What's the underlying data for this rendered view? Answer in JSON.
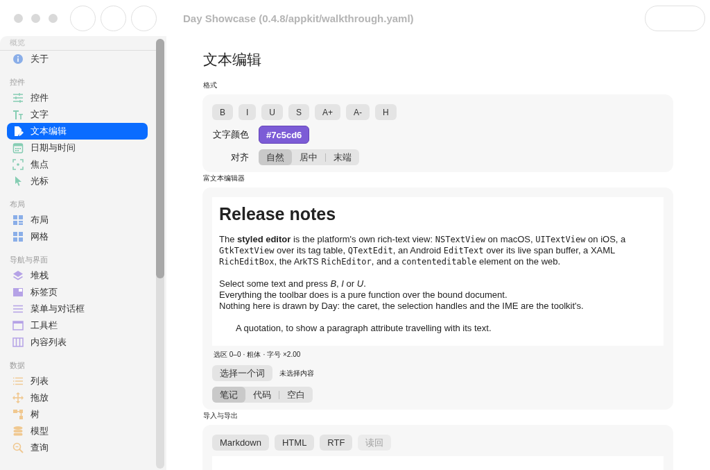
{
  "window": {
    "title": "Day Showcase (0.4.8/appkit/walkthrough.yaml)"
  },
  "sidebar": {
    "sections": [
      {
        "header": "概览",
        "items": [
          {
            "label": "关于",
            "kind": "info",
            "selected": false
          }
        ]
      },
      {
        "header": "控件",
        "items": [
          {
            "label": "控件",
            "kind": "sliders",
            "selected": false
          },
          {
            "label": "文字",
            "kind": "text",
            "selected": false
          },
          {
            "label": "文本编辑",
            "kind": "edit",
            "selected": true
          },
          {
            "label": "日期与时间",
            "kind": "calendar",
            "selected": false
          },
          {
            "label": "焦点",
            "kind": "focus",
            "selected": false
          },
          {
            "label": "光标",
            "kind": "cursor",
            "selected": false
          }
        ]
      },
      {
        "header": "布局",
        "items": [
          {
            "label": "布局",
            "kind": "layout",
            "selected": false
          },
          {
            "label": "网格",
            "kind": "grid",
            "selected": false
          }
        ]
      },
      {
        "header": "导航与界面",
        "items": [
          {
            "label": "堆栈",
            "kind": "stack",
            "selected": false
          },
          {
            "label": "标签页",
            "kind": "tab",
            "selected": false
          },
          {
            "label": "菜单与对话框",
            "kind": "menu",
            "selected": false
          },
          {
            "label": "工具栏",
            "kind": "toolbar",
            "selected": false
          },
          {
            "label": "内容列表",
            "kind": "columns",
            "selected": false
          }
        ]
      },
      {
        "header": "数据",
        "items": [
          {
            "label": "列表",
            "kind": "list",
            "selected": false
          },
          {
            "label": "拖放",
            "kind": "move",
            "selected": false
          },
          {
            "label": "树",
            "kind": "tree",
            "selected": false
          },
          {
            "label": "模型",
            "kind": "database",
            "selected": false
          },
          {
            "label": "查询",
            "kind": "search",
            "selected": false
          }
        ]
      }
    ]
  },
  "page": {
    "title": "文本编辑",
    "format": {
      "label": "格式",
      "buttons": [
        "B",
        "I",
        "U",
        "S",
        "A+",
        "A-",
        "H"
      ],
      "color_label": "文字颜色",
      "color_value": "#7c5cd6",
      "align_label": "对齐",
      "align": [
        {
          "label": "自然",
          "selected": true
        },
        {
          "label": "居中",
          "selected": false
        },
        {
          "label": "末端",
          "selected": false
        }
      ]
    },
    "rich": {
      "label": "富文本编辑器",
      "heading": "Release notes",
      "blocks": [
        {
          "kind": "para",
          "lines": [
            [
              {
                "kind": "plain",
                "text": "The "
              },
              {
                "kind": "bold",
                "text": "styled editor"
              },
              {
                "kind": "plain",
                "text": " is the platform's own rich-text view: "
              },
              {
                "kind": "code",
                "text": "NSTextView"
              },
              {
                "kind": "plain",
                "text": " on macOS, "
              },
              {
                "kind": "code",
                "text": "UITextView"
              },
              {
                "kind": "plain",
                "text": " on iOS, a "
              },
              {
                "kind": "code",
                "text": "GtkTextView"
              },
              {
                "kind": "plain",
                "text": " over its tag table, "
              },
              {
                "kind": "code",
                "text": "QTextEdit"
              },
              {
                "kind": "plain",
                "text": ", an Android "
              },
              {
                "kind": "code",
                "text": "EditText"
              },
              {
                "kind": "plain",
                "text": " over its live span buffer, a XAML "
              },
              {
                "kind": "code",
                "text": "RichEditBox"
              },
              {
                "kind": "plain",
                "text": ", the ArkTS "
              },
              {
                "kind": "code",
                "text": "RichEditor"
              },
              {
                "kind": "plain",
                "text": ", and a "
              },
              {
                "kind": "code",
                "text": "contenteditable"
              },
              {
                "kind": "plain",
                "text": " element on the web."
              }
            ]
          ]
        },
        {
          "kind": "para",
          "lines": [
            [
              {
                "kind": "plain",
                "text": "Select some text and press "
              },
              {
                "kind": "italic",
                "text": "B"
              },
              {
                "kind": "plain",
                "text": ", "
              },
              {
                "kind": "italic",
                "text": "I"
              },
              {
                "kind": "plain",
                "text": " or "
              },
              {
                "kind": "italic",
                "text": "U"
              },
              {
                "kind": "plain",
                "text": "."
              }
            ],
            [
              {
                "kind": "plain",
                "text": "Everything the toolbar does is a pure function over the bound document."
              }
            ],
            [
              {
                "kind": "plain",
                "text": "Nothing here is drawn by Day: the caret, the selection handles and the IME are the toolkit's."
              }
            ]
          ]
        },
        {
          "kind": "quote",
          "lines": [
            [
              {
                "kind": "plain",
                "text": "A quotation, to show a paragraph attribute travelling with its text."
              }
            ]
          ]
        }
      ],
      "status": "选区 0–0 · 粗体 · 字号 ×2.00",
      "select_button": "选择一个词",
      "selection_note": "未选择内容",
      "modes": [
        {
          "label": "笔记",
          "selected": true
        },
        {
          "label": "代码",
          "selected": false
        },
        {
          "label": "空白",
          "selected": false
        }
      ]
    },
    "export": {
      "label": "导入与导出",
      "buttons": [
        {
          "label": "Markdown",
          "disabled": false
        },
        {
          "label": "HTML",
          "disabled": false
        },
        {
          "label": "RTF",
          "disabled": false
        },
        {
          "label": "读回",
          "disabled": true
        }
      ]
    }
  }
}
